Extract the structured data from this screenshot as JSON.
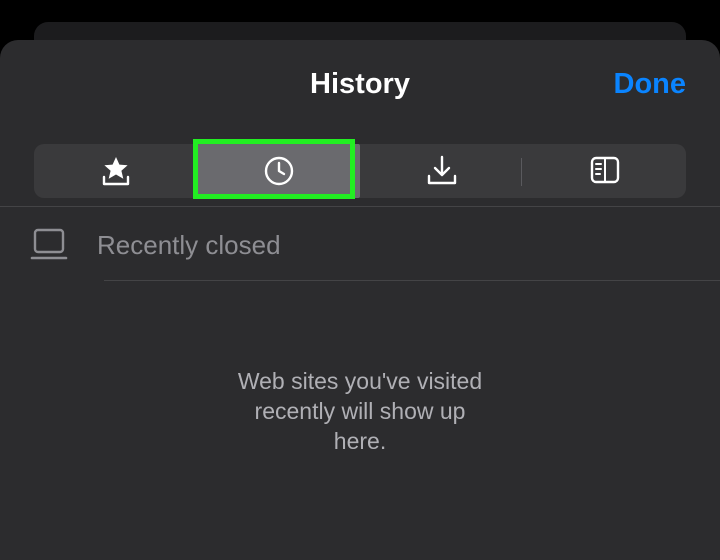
{
  "header": {
    "title": "History",
    "done_label": "Done"
  },
  "tabs": [
    {
      "icon": "bookmarks-star-icon",
      "selected": false
    },
    {
      "icon": "history-clock-icon",
      "selected": true
    },
    {
      "icon": "downloads-icon",
      "selected": false
    },
    {
      "icon": "reading-list-icon",
      "selected": false
    }
  ],
  "list": {
    "section_icon": "laptop-icon",
    "section_label": "Recently closed"
  },
  "empty_state": {
    "lines": [
      "Web sites you've visited",
      "recently will show up",
      "here."
    ]
  },
  "colors": {
    "accent": "#0a84ff",
    "highlight": "#22ee22",
    "sheet_bg": "#2c2c2e",
    "control_bg": "#3a3a3c"
  }
}
